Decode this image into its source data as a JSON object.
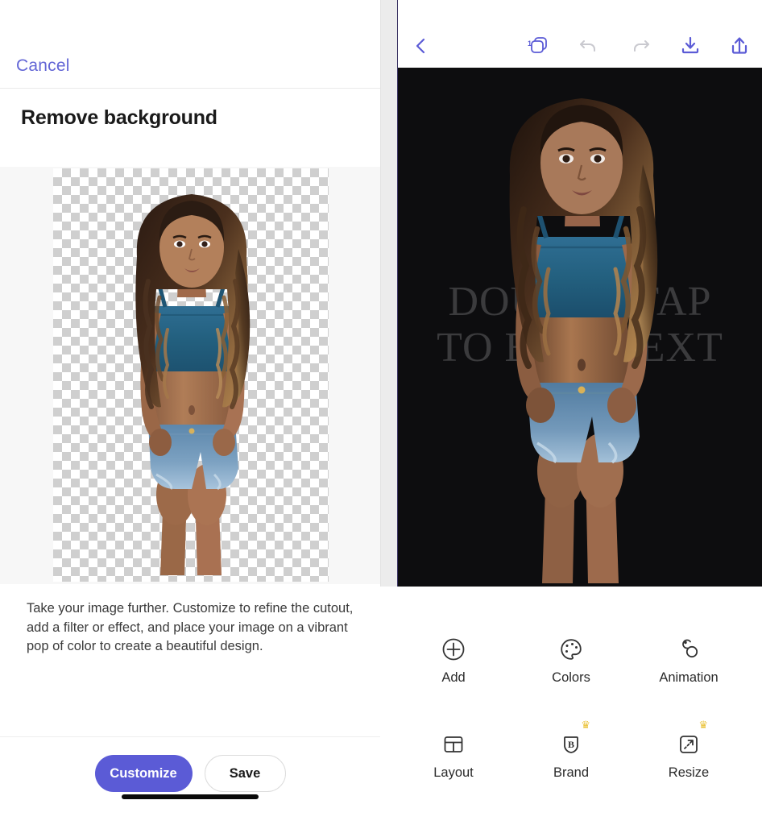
{
  "left_panel": {
    "cancel_label": "Cancel",
    "title": "Remove background",
    "description": "Take your image further. Customize to refine the cutout, add a filter or effect, and place your image on a vibrant pop of color to create a beautiful design.",
    "primary_button": "Customize",
    "secondary_button": "Save",
    "preview": {
      "transparency_checker": "checkerboard",
      "subject": "girl-cutout-transparent"
    },
    "colors": {
      "accent": "#5b5bd6",
      "cancel_link": "#6366d6",
      "preview_bg": "#f7f7f7",
      "checker_light": "#ffffff",
      "checker_dark": "#cfcfcf"
    }
  },
  "right_panel": {
    "toolbar": {
      "back_icon": "chevron-left-icon",
      "pages_icon": "pages-icon",
      "pages_count": "1",
      "undo_icon": "undo-icon",
      "undo_enabled": false,
      "redo_icon": "redo-icon",
      "redo_enabled": false,
      "download_icon": "download-icon",
      "share_icon": "share-icon",
      "active_color": "#5b5bd6",
      "disabled_color": "#c9c9cf"
    },
    "canvas": {
      "background": "#0d0d0f",
      "watermark_line1": "DOUBLE TAP",
      "watermark_line2": "TO EDIT TEXT",
      "subject": "girl-on-black-background"
    },
    "tools": [
      {
        "label": "Add",
        "icon": "plus-circle-icon",
        "premium": false
      },
      {
        "label": "Colors",
        "icon": "palette-icon",
        "premium": false
      },
      {
        "label": "Animation",
        "icon": "animation-icon",
        "premium": false
      },
      {
        "label": "Layout",
        "icon": "layout-icon",
        "premium": false
      },
      {
        "label": "Brand",
        "icon": "brand-icon",
        "premium": true
      },
      {
        "label": "Resize",
        "icon": "resize-icon",
        "premium": true
      }
    ],
    "premium_badge_glyph": "♛",
    "premium_badge_color": "#eac33a"
  },
  "system": {
    "home_indicator": "home-indicator"
  }
}
